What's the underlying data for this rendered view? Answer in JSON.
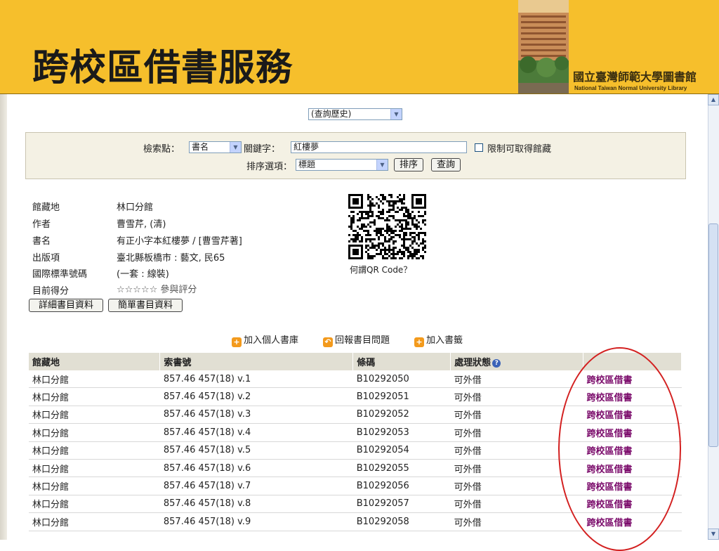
{
  "banner": {
    "title": "跨校區借書服務",
    "logo_zh": "國立臺灣師範大學圖書館",
    "logo_en": "National Taiwan Normal University Library"
  },
  "history_select": {
    "value": "(查詢歷史)"
  },
  "search": {
    "field_label": "檢索點：",
    "field_value": "書名",
    "keyword_label": "關鍵字：",
    "keyword_value": "紅樓夢",
    "limit_label": "限制可取得館藏",
    "sort_label": "排序選項：",
    "sort_value": "標題",
    "sort_button": "排序",
    "query_button": "查詢"
  },
  "record": {
    "fields": [
      {
        "label": "館藏地",
        "value": "林口分館"
      },
      {
        "label": "作者",
        "value": "曹雪芹, (清)"
      },
      {
        "label": "書名",
        "value": "有正小字本紅樓夢 / [曹雪芹著]"
      },
      {
        "label": "出版項",
        "value": "臺北縣板橋市 : 藝文, 民65"
      },
      {
        "label": "國際標準號碼",
        "value": "(一套 : 線裝)"
      },
      {
        "label": "目前得分",
        "value": "參與評分"
      }
    ],
    "stars": "☆☆☆☆☆",
    "qr_label": "何謂QR Code？",
    "detail_button": "詳細書目資料",
    "brief_button": "簡單書目資料"
  },
  "actions": {
    "add_library": "加入個人書庫",
    "report_problem": "回報書目問題",
    "add_bookmark": "加入書籤"
  },
  "holdings": {
    "headers": [
      "館藏地",
      "索書號",
      "條碼",
      "處理狀態",
      ""
    ],
    "rows": [
      [
        "林口分館",
        "857.46 457(18) v.1",
        "B10292050",
        "可外借",
        "跨校區借書"
      ],
      [
        "林口分館",
        "857.46 457(18) v.2",
        "B10292051",
        "可外借",
        "跨校區借書"
      ],
      [
        "林口分館",
        "857.46 457(18) v.3",
        "B10292052",
        "可外借",
        "跨校區借書"
      ],
      [
        "林口分館",
        "857.46 457(18) v.4",
        "B10292053",
        "可外借",
        "跨校區借書"
      ],
      [
        "林口分館",
        "857.46 457(18) v.5",
        "B10292054",
        "可外借",
        "跨校區借書"
      ],
      [
        "林口分館",
        "857.46 457(18) v.6",
        "B10292055",
        "可外借",
        "跨校區借書"
      ],
      [
        "林口分館",
        "857.46 457(18) v.7",
        "B10292056",
        "可外借",
        "跨校區借書"
      ],
      [
        "林口分館",
        "857.46 457(18) v.8",
        "B10292057",
        "可外借",
        "跨校區借書"
      ],
      [
        "林口分館",
        "857.46 457(18) v.9",
        "B10292058",
        "可外借",
        "跨校區借書"
      ]
    ]
  },
  "colors": {
    "banner": "#f6bf2c",
    "borrow_link": "#7a0a6a",
    "highlight_oval": "#d32020",
    "action_icon": "#f39a1c"
  }
}
